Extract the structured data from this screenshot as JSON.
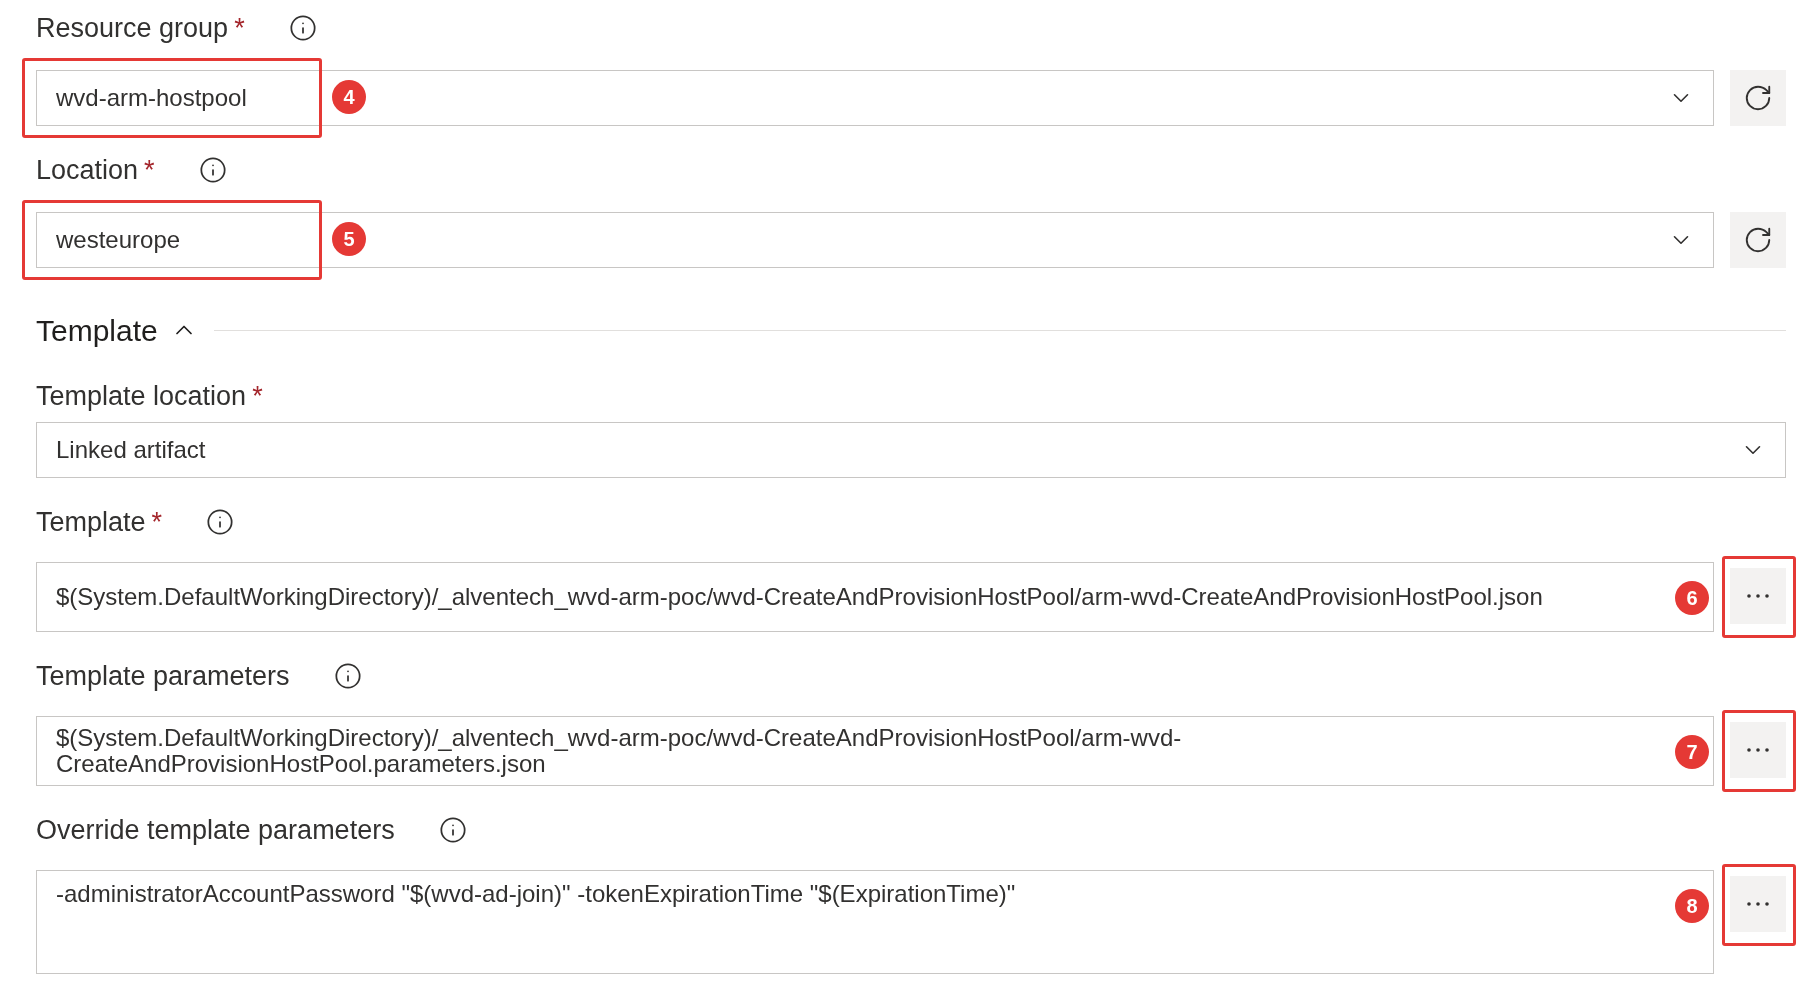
{
  "fields": [
    {
      "kind": "select_refresh",
      "label": "Resource group",
      "required_mark": "*",
      "info": true,
      "value": "wvd-arm-hostpool",
      "callout": "4"
    },
    {
      "kind": "select_refresh",
      "label": "Location",
      "required_mark": "*",
      "info": true,
      "value": "westeurope",
      "callout": "5"
    }
  ],
  "section": {
    "title": "Template",
    "expanded": true
  },
  "section_fields": [
    {
      "kind": "select",
      "label": "Template location",
      "required_mark": "*",
      "info": false,
      "value": "Linked artifact"
    },
    {
      "kind": "browse",
      "label": "Template",
      "required_mark": "*",
      "info": true,
      "value": "$(System.DefaultWorkingDirectory)/_alventech_wvd-arm-poc/wvd-CreateAndProvisionHostPool/arm-wvd-CreateAndProvisionHostPool.json",
      "callout": "6"
    },
    {
      "kind": "browse",
      "label": "Template parameters",
      "info": true,
      "value": "$(System.DefaultWorkingDirectory)/_alventech_wvd-arm-poc/wvd-CreateAndProvisionHostPool/arm-wvd-\nCreateAndProvisionHostPool.parameters.json",
      "callout": "7"
    },
    {
      "kind": "browse_tall",
      "label": "Override template parameters",
      "info": true,
      "value": "-administratorAccountPassword \"$(wvd-ad-join)\" -tokenExpirationTime \"$(ExpirationTime)\"",
      "callout": "8"
    }
  ]
}
